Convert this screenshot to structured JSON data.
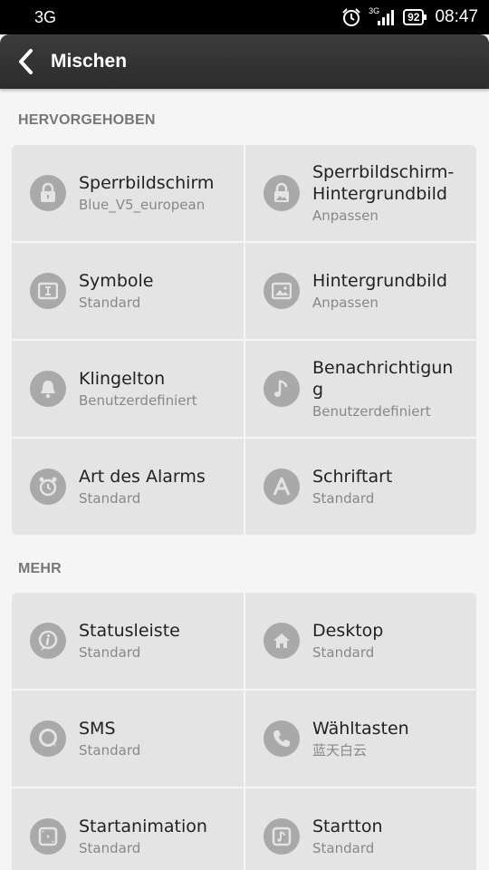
{
  "status_bar": {
    "network": "3G",
    "net_small": "3G",
    "battery": "92",
    "time": "08:47"
  },
  "header": {
    "title": "Mischen"
  },
  "sections": {
    "featured": {
      "label": "HERVORGEHOBEN",
      "items": [
        {
          "title": "Sperrbildschirm",
          "sub": "Blue_V5_european",
          "icon": "lock-icon"
        },
        {
          "title": "Sperrbildschirm-\nHintergrundbild",
          "sub": "Anpassen",
          "icon": "lock-wallpaper-icon"
        },
        {
          "title": "Symbole",
          "sub": "Standard",
          "icon": "icons-icon"
        },
        {
          "title": "Hintergrundbild",
          "sub": "Anpassen",
          "icon": "wallpaper-icon"
        },
        {
          "title": "Klingelton",
          "sub": "Benutzerdefiniert",
          "icon": "bell-icon"
        },
        {
          "title": "Benachrichtigun\ng",
          "sub": "Benutzerdefiniert",
          "icon": "music-note-icon"
        },
        {
          "title": "Art des Alarms",
          "sub": "Standard",
          "icon": "alarm-clock-icon"
        },
        {
          "title": "Schriftart",
          "sub": "Standard",
          "icon": "font-icon"
        }
      ]
    },
    "more": {
      "label": "MEHR",
      "items": [
        {
          "title": "Statusleiste",
          "sub": "Standard",
          "icon": "info-icon"
        },
        {
          "title": "Desktop",
          "sub": "Standard",
          "icon": "home-icon"
        },
        {
          "title": "SMS",
          "sub": "Standard",
          "icon": "message-icon"
        },
        {
          "title": "Wähltasten",
          "sub": "蓝天白云",
          "icon": "phone-icon"
        },
        {
          "title": "Startanimation",
          "sub": "Standard",
          "icon": "boot-animation-icon"
        },
        {
          "title": "Startton",
          "sub": "Standard",
          "icon": "boot-sound-icon"
        }
      ]
    }
  },
  "colors": {
    "tile_bg": "#e4e4e4",
    "icon_bg": "#a9a9a9",
    "header_bg": "#333333"
  }
}
